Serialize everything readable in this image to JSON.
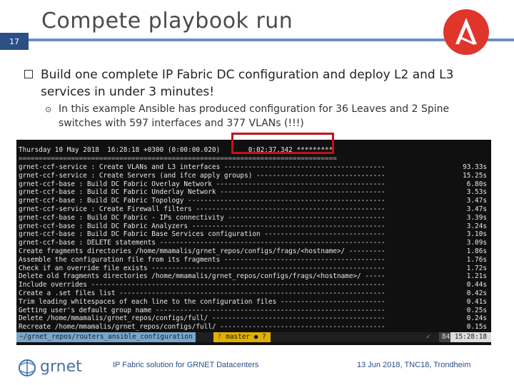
{
  "slide": {
    "title": "Compete playbook run",
    "number": "17",
    "bullet_main": "Build one complete IP Fabric DC configuration and deploy L2 and L3 services in under 3 minutes!",
    "bullet_sub": "In this example Ansible has produced configuration for 36 Leaves and 2 Spine switches with 597 interfaces and 377 VLANs (!!!)"
  },
  "terminal": {
    "header_line": "Thursday 10 May 2018  16:28:18 +0300 (0:00:00.020)       0:02:37.342 *********",
    "separator": "===============================================================================",
    "rows": [
      {
        "task": "grnet-ccf-service : Create VLANs and L3 interfaces ----------------------------------------",
        "time": "93.33s"
      },
      {
        "task": "grnet-ccf-service : Create Servers (and ifce apply groups) --------------------------------",
        "time": "15.25s"
      },
      {
        "task": "grnet-ccf-base : Build DC Fabric Overlay Network ------------------------------------------",
        "time": "6.80s"
      },
      {
        "task": "grnet-ccf-base : Build DC Fabric Underlay Network -----------------------------------------",
        "time": "3.53s"
      },
      {
        "task": "grnet-ccf-base : Build DC Fabric Topology -------------------------------------------------",
        "time": "3.47s"
      },
      {
        "task": "grnet-ccf-service : Create Firewall filters -----------------------------------------------",
        "time": "3.47s"
      },
      {
        "task": "grnet-ccf-base : Build DC Fabric - IPs connectivity ---------------------------------------",
        "time": "3.39s"
      },
      {
        "task": "grnet-ccf-base : Build DC Fabric Analyzers ------------------------------------------------",
        "time": "3.24s"
      },
      {
        "task": "grnet-ccf-base : Build DC Fabric Base Services configuration ------------------------------",
        "time": "3.10s"
      },
      {
        "task": "grnet-ccf-base : DELETE statements --------------------------------------------------------",
        "time": "3.09s"
      },
      {
        "task": "Create fragments directories /home/mmamalis/grnet_repos/configs/frags/<hostname>/ ---------",
        "time": "1.86s"
      },
      {
        "task": "Assemble the configuration file from its fragments ----------------------------------------",
        "time": "1.76s"
      },
      {
        "task": "Check if an override file exists ----------------------------------------------------------",
        "time": "1.72s"
      },
      {
        "task": "Delete old fragments directories /home/mmamalis/grnet_repos/configs/frags/<hostname>/ -----",
        "time": "1.21s"
      },
      {
        "task": "Include overrides -------------------------------------------------------------------------",
        "time": "0.44s"
      },
      {
        "task": "Create a .set files list ------------------------------------------------------------------",
        "time": "0.42s"
      },
      {
        "task": "Trim leading whitespaces of each line to the configuration files --------------------------",
        "time": "0.41s"
      },
      {
        "task": "Getting user's default group name ---------------------------------------------------------",
        "time": "0.25s"
      },
      {
        "task": "Delete /home/mmamalis/grnet_repos/configs/full/ -------------------------------------------",
        "time": "0.24s"
      },
      {
        "task": "Recreate /home/mmamalis/grnet_repos/configs/full/ -----------------------------------------",
        "time": "0.15s"
      }
    ],
    "status_path": "~/grnet_repos/routers_ansible_configuration",
    "status_branch": "ᚠ master ● ?",
    "status_check": "✓",
    "status_num": "845",
    "status_clock": "15:28:18"
  },
  "footer": {
    "logo_text": "grnet",
    "center": "IP Fabric solution for GRNET Datacenters",
    "right": "13 Jun 2018, TNC18, Trondheim"
  },
  "colors": {
    "accent_blue": "#2c4f86",
    "rule_blue": "#6b8fc2",
    "ansible_red": "#e0352b",
    "highlight_red": "#c0121a"
  }
}
